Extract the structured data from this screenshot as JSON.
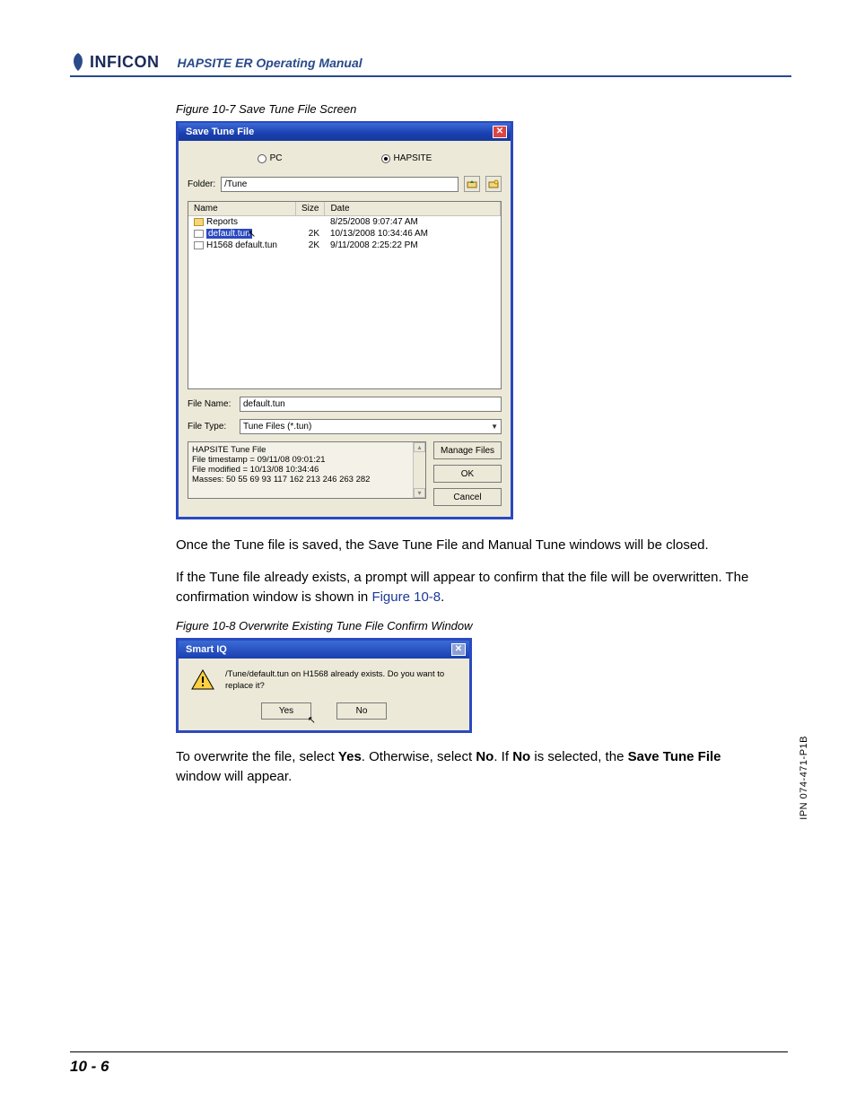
{
  "header": {
    "brand": "INFICON",
    "manual_title": "HAPSITE ER Operating Manual"
  },
  "figure1": {
    "caption": "Figure 10-7  Save Tune File Screen",
    "dialog": {
      "title": "Save Tune File",
      "radio_pc": "PC",
      "radio_hapsite": "HAPSITE",
      "folder_label": "Folder:",
      "folder_value": "/Tune",
      "columns": {
        "name": "Name",
        "size": "Size",
        "date": "Date"
      },
      "rows": [
        {
          "name": "Reports",
          "size": "",
          "date": "8/25/2008 9:07:47 AM",
          "type": "folder"
        },
        {
          "name": "default.tun",
          "size": "2K",
          "date": "10/13/2008 10:34:46 AM",
          "type": "file",
          "selected": true
        },
        {
          "name": "H1568 default.tun",
          "size": "2K",
          "date": "9/11/2008 2:25:22 PM",
          "type": "file"
        }
      ],
      "file_name_label": "File Name:",
      "file_name_value": "default.tun",
      "file_type_label": "File Type:",
      "file_type_value": "Tune Files (*.tun)",
      "info_lines": [
        "HAPSITE Tune File",
        "File timestamp = 09/11/08 09:01:21",
        "File modified = 10/13/08 10:34:46",
        "Masses: 50 55 69 93 117 162 213 246 263 282"
      ],
      "buttons": {
        "manage": "Manage Files",
        "ok": "OK",
        "cancel": "Cancel"
      }
    }
  },
  "para1": "Once the Tune file is saved, the Save Tune File and Manual Tune windows will be closed.",
  "para2_a": "If the Tune file already exists, a prompt will appear to confirm that the file will be overwritten. The confirmation window is shown in ",
  "para2_link": "Figure 10-8",
  "para2_b": ".",
  "figure2": {
    "caption": "Figure 10-8  Overwrite Existing Tune File Confirm Window",
    "dialog": {
      "title": "Smart IQ",
      "message": "/Tune/default.tun on H1568 already exists. Do you want to replace it?",
      "yes": "Yes",
      "no": "No"
    }
  },
  "para3_a": "To overwrite the file, select ",
  "para3_b": "Yes",
  "para3_c": ". Otherwise, select ",
  "para3_d": "No",
  "para3_e": ". If ",
  "para3_f": "No",
  "para3_g": " is selected, the ",
  "para3_h": "Save Tune File",
  "para3_i": " window will appear.",
  "page_number": "10 - 6",
  "side_ipn": "IPN 074-471-P1B"
}
